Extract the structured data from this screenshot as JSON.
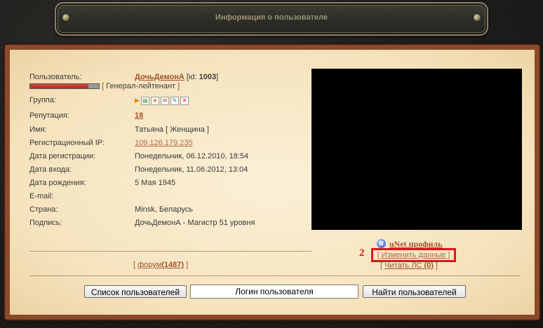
{
  "header": {
    "title": "Информация о пользователе"
  },
  "profile": {
    "user_label": "Пользователь:",
    "username": "ДочьДемонА",
    "id_prefix": "[id:",
    "id_value": "1003",
    "id_suffix": "]",
    "rank_open": "[",
    "rank": "Генерал-лейтенант",
    "rank_close": "]",
    "rank_progress": 0.85,
    "group_label": "Группа:",
    "reputation_label": "Репутация:",
    "reputation_value": "18",
    "name_label": "Имя:",
    "name_value": "Татьяна",
    "gender_text": "[ Женщина ]",
    "regip_label": "Регистрационный IP:",
    "regip_value": "109.126.179.235",
    "regdate_label": "Дата регистрации:",
    "regdate_value": "Понедельник, 06.12.2010, 18:54",
    "login_date_label": "Дата входа:",
    "login_date_value": "Понедельник, 11.06.2012, 13:04",
    "birth_label": "Дата рождения:",
    "birth_value": "5 Мая 1945",
    "email_label": "E-mail:",
    "email_value": "",
    "country_label": "Страна:",
    "country_value": "Minsk, Беларусь",
    "signature_label": "Подпись:",
    "signature_value": "ДочьДемонА - Магистр 51 уровня"
  },
  "actions": {
    "forum_open": "[",
    "forum_label": "форум",
    "forum_count": "(1487)",
    "forum_close": "]",
    "unet_label": "uNet профиль",
    "edit_label": "[ Изменить данные ]",
    "marker": "2",
    "pm_open": "[",
    "pm_label": "Читать ЛС",
    "pm_count": "(0)",
    "pm_close": "]"
  },
  "search": {
    "user_list_button": "Список пользователей",
    "login_placeholder": "Логин пользователя",
    "find_button": "Найти пользователей"
  },
  "colors": {
    "link": "#a0522d",
    "highlight": "#e0161c",
    "parchment": "#f7e8c8"
  }
}
